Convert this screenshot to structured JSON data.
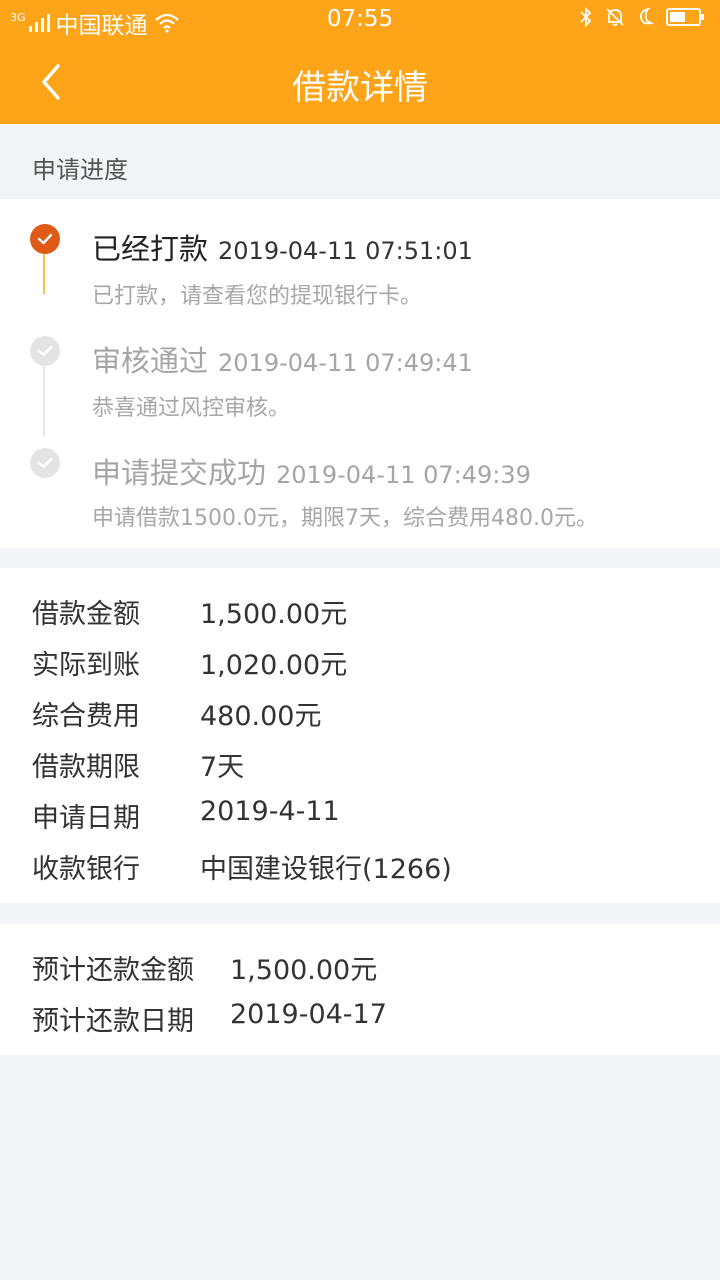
{
  "status_bar": {
    "network": "3G",
    "carrier": "中国联通",
    "time": "07:55"
  },
  "navbar": {
    "title": "借款详情"
  },
  "progress": {
    "section_title": "申请进度",
    "steps": [
      {
        "title": "已经打款",
        "time": "2019-04-11 07:51:01",
        "desc": "已打款，请查看您的提现银行卡。"
      },
      {
        "title": "审核通过",
        "time": "2019-04-11 07:49:41",
        "desc": "恭喜通过风控审核。"
      },
      {
        "title": "申请提交成功",
        "time": "2019-04-11 07:49:39",
        "desc": "申请借款1500.0元，期限7天，综合费用480.0元。"
      }
    ]
  },
  "info": {
    "rows": [
      {
        "label": "借款金额",
        "value": "1,500.00元"
      },
      {
        "label": "实际到账",
        "value": "1,020.00元"
      },
      {
        "label": "综合费用",
        "value": "480.00元"
      },
      {
        "label": "借款期限",
        "value": "7天"
      },
      {
        "label": "申请日期",
        "value": "2019-4-11"
      },
      {
        "label": "收款银行",
        "value": "中国建设银行(1266)"
      }
    ]
  },
  "repay": {
    "rows": [
      {
        "label": "预计还款金额",
        "value": "1,500.00元"
      },
      {
        "label": "预计还款日期",
        "value": "2019-04-17"
      }
    ]
  },
  "colors": {
    "header": "#fda418",
    "active_dot": "#e05a17",
    "background": "#f3f4f8"
  }
}
